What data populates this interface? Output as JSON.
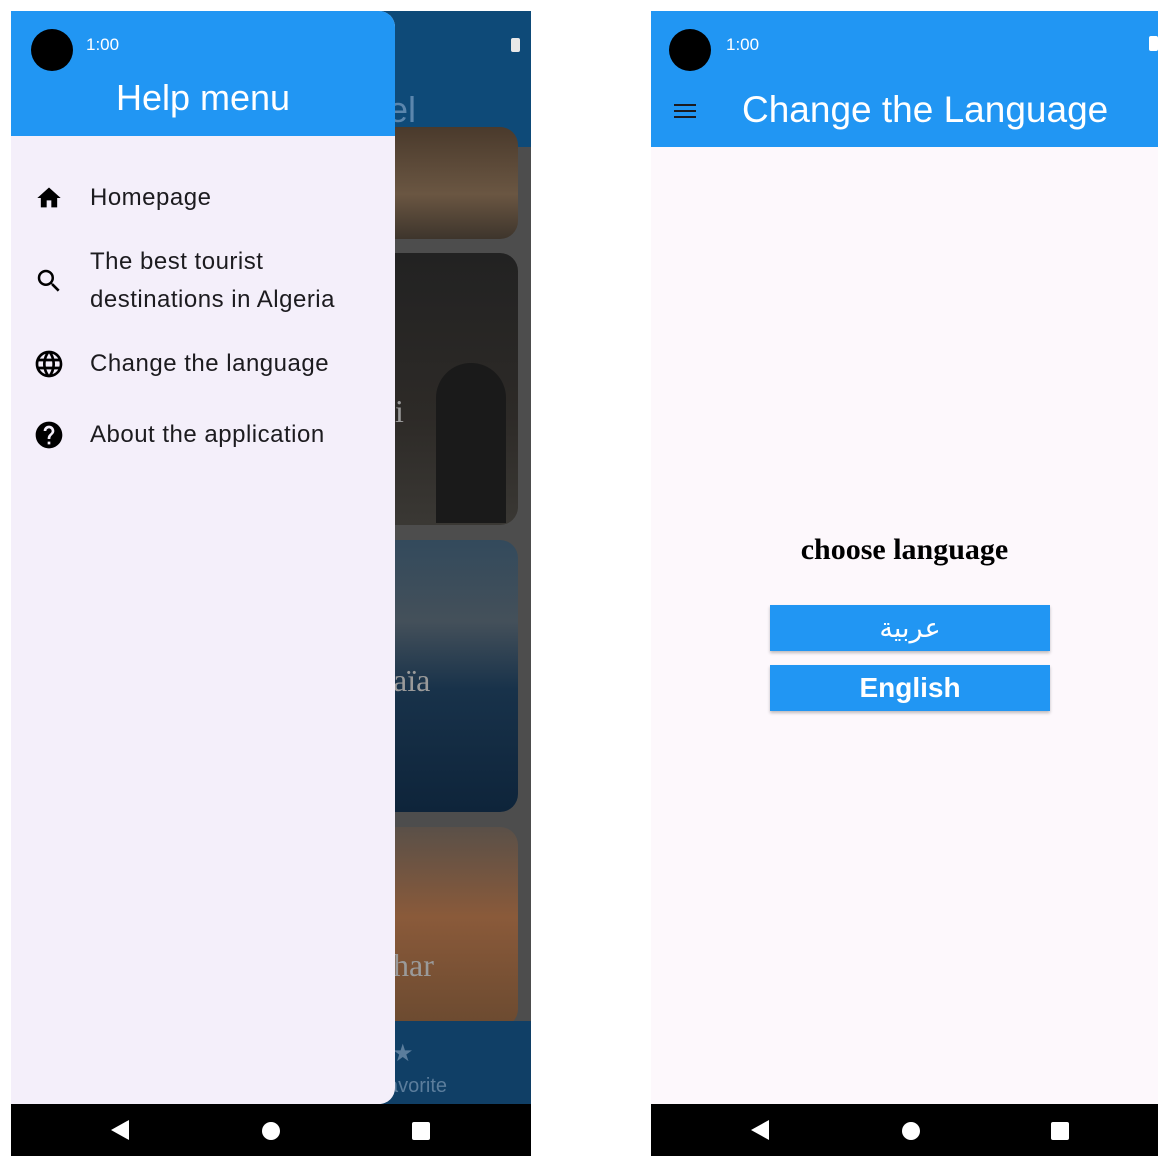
{
  "left_screen": {
    "status": {
      "time": "1:00"
    },
    "background": {
      "title_fragment": "el",
      "card_labels": [
        "i",
        "aïa",
        "har"
      ],
      "bottom_nav_label": "avorite"
    },
    "drawer": {
      "title": "Help menu",
      "items": [
        {
          "icon": "home-icon",
          "label": "Homepage"
        },
        {
          "icon": "search-icon",
          "label_line1": "The best tourist",
          "label_line2": "destinations in Algeria"
        },
        {
          "icon": "globe-icon",
          "label": "Change the language"
        },
        {
          "icon": "help-circle-icon",
          "label": "About the application"
        }
      ]
    }
  },
  "right_screen": {
    "status": {
      "time": "1:00"
    },
    "appbar": {
      "title": "Change the Language"
    },
    "content": {
      "heading": "choose language",
      "buttons": [
        {
          "label": "عربية"
        },
        {
          "label": "English"
        }
      ]
    }
  },
  "colors": {
    "primary": "#2196f3",
    "drawer_bg": "#f4effa",
    "page_bg": "#fdf8fc",
    "nav_bar": "#000000"
  }
}
